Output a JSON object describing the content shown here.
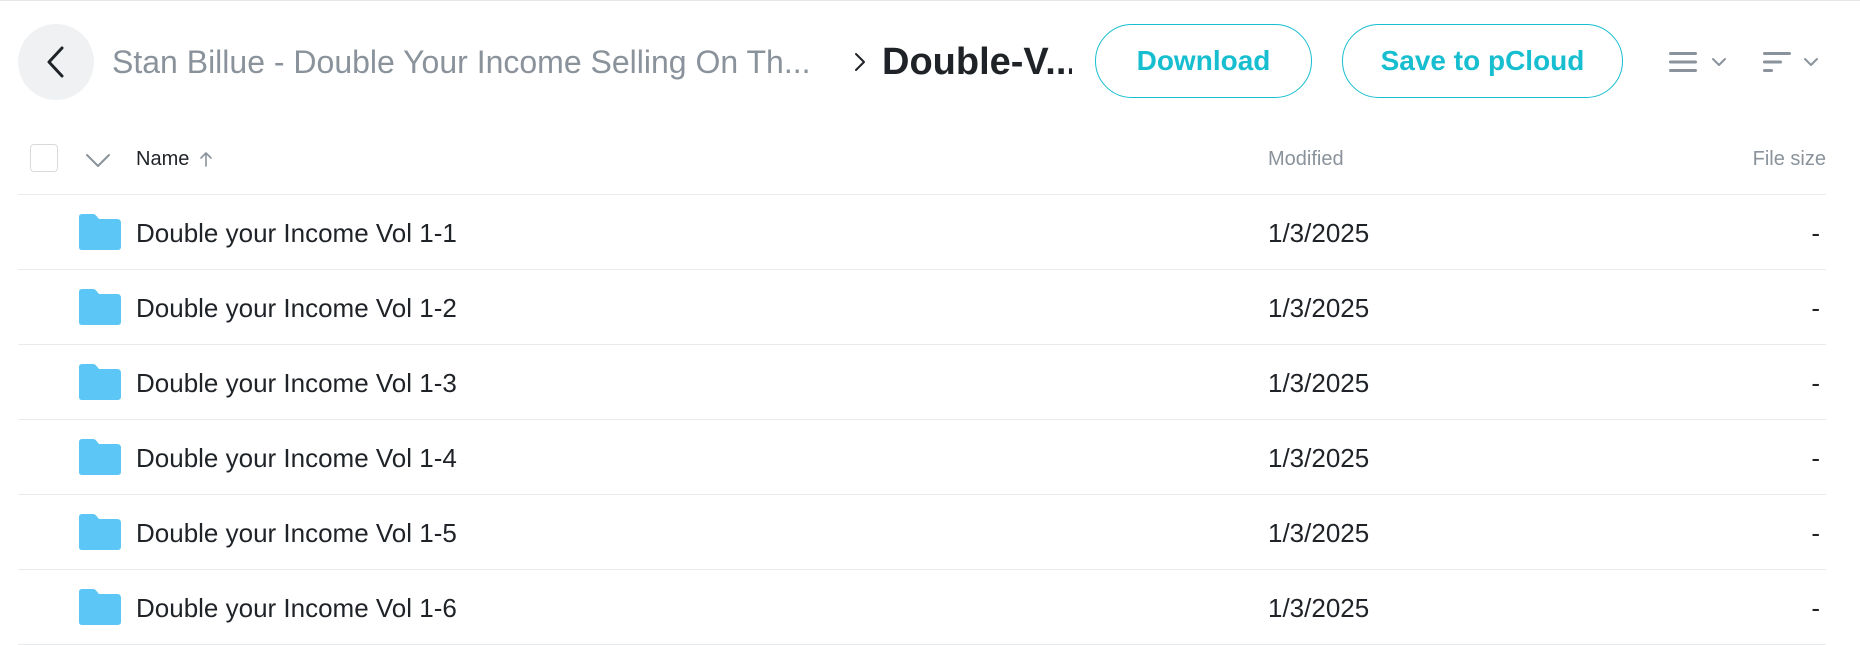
{
  "breadcrumb": {
    "parent": "Stan Billue - Double Your Income Selling On Th...",
    "current": "Double-V..."
  },
  "actions": {
    "download_label": "Download",
    "save_label": "Save to pCloud"
  },
  "icons": {
    "back": "chevron-left-icon",
    "separator": "chevron-right-icon",
    "list_view": "list-view-icon",
    "sort": "sort-icon",
    "folder": "folder-icon"
  },
  "colors": {
    "accent": "#17bed0",
    "folder": "#5cc7f6",
    "muted_text": "#8a939b"
  },
  "table": {
    "columns": {
      "name": "Name",
      "modified": "Modified",
      "size": "File size"
    },
    "sort": {
      "column": "name",
      "direction": "ascending"
    },
    "rows": [
      {
        "name": "Double your Income Vol 1-1",
        "modified": "1/3/2025",
        "size": "-"
      },
      {
        "name": "Double your Income Vol 1-2",
        "modified": "1/3/2025",
        "size": "-"
      },
      {
        "name": "Double your Income Vol 1-3",
        "modified": "1/3/2025",
        "size": "-"
      },
      {
        "name": "Double your Income Vol 1-4",
        "modified": "1/3/2025",
        "size": "-"
      },
      {
        "name": "Double your Income Vol 1-5",
        "modified": "1/3/2025",
        "size": "-"
      },
      {
        "name": "Double your Income Vol 1-6",
        "modified": "1/3/2025",
        "size": "-"
      }
    ]
  }
}
